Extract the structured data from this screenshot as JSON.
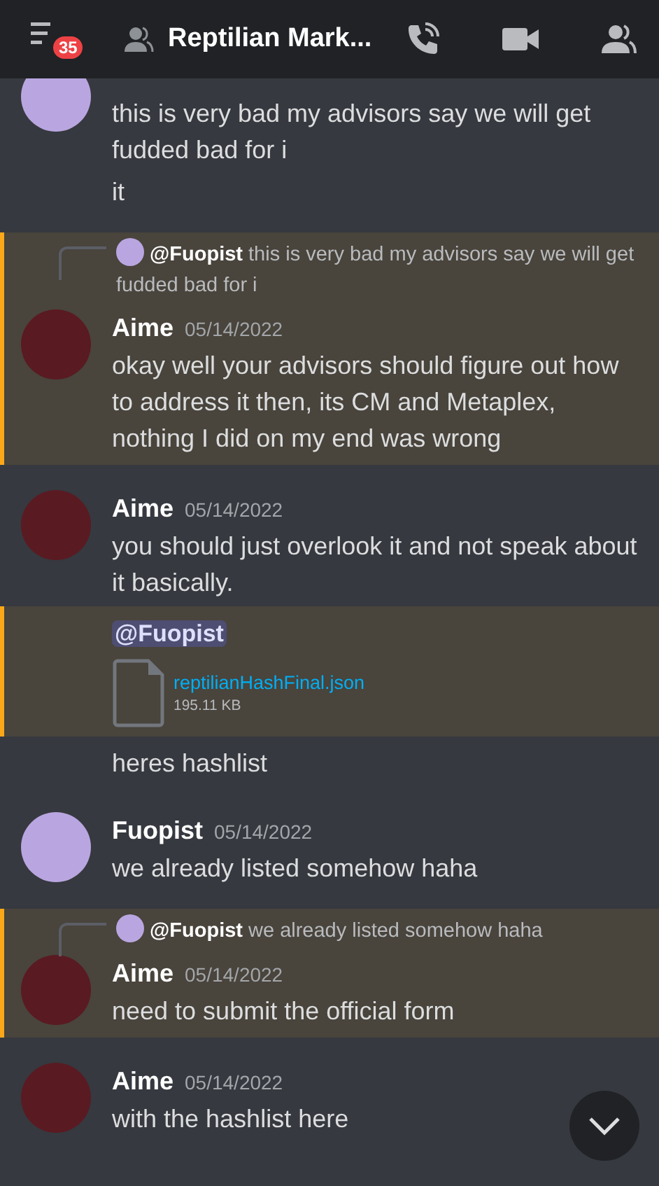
{
  "header": {
    "unread_badge": "35",
    "title": "Reptilian Mark..."
  },
  "messages": [
    {
      "kind": "cut",
      "highlighted": false,
      "avatar": {
        "color": "#b9a6e0"
      },
      "paragraphs": [
        "this is very bad my advisors say we will get fudded bad for i",
        "it"
      ]
    },
    {
      "kind": "message",
      "highlighted": true,
      "reply": {
        "author": "@Fuopist",
        "avatar": {
          "color": "#b9a6e0"
        },
        "text": "this is very bad my advisors say we will get fudded bad for i"
      },
      "author": "Aime",
      "time": "05/14/2022",
      "avatar": {
        "color": "#5a1a22"
      },
      "paragraphs": [
        "okay well your advisors should figure out how to address it then, its CM and Metaplex, nothing I did on my end was wrong"
      ]
    },
    {
      "kind": "message",
      "highlighted": false,
      "author": "Aime",
      "time": "05/14/2022",
      "avatar": {
        "color": "#5a1a22"
      },
      "paragraphs": [
        "you should just overlook it and not speak about it basically."
      ]
    },
    {
      "kind": "continuation",
      "highlighted": true,
      "mention": "@Fuopist",
      "attachment": {
        "name": "reptilianHashFinal.json",
        "size": "195.11 KB"
      }
    },
    {
      "kind": "continuation",
      "highlighted": false,
      "paragraphs": [
        "heres hashlist"
      ]
    },
    {
      "kind": "message",
      "highlighted": false,
      "author": "Fuopist",
      "time": "05/14/2022",
      "avatar": {
        "color": "#b9a6e0"
      },
      "paragraphs": [
        "we already listed somehow haha"
      ]
    },
    {
      "kind": "message",
      "highlighted": true,
      "reply": {
        "author": "@Fuopist",
        "avatar": {
          "color": "#b9a6e0"
        },
        "text": "we already listed somehow haha"
      },
      "author": "Aime",
      "time": "05/14/2022",
      "avatar": {
        "color": "#5a1a22"
      },
      "paragraphs": [
        "need to submit the official form"
      ]
    },
    {
      "kind": "message",
      "highlighted": false,
      "author": "Aime",
      "time": "05/14/2022",
      "avatar": {
        "color": "#5a1a22"
      },
      "paragraphs": [
        "with the hashlist here"
      ]
    }
  ]
}
